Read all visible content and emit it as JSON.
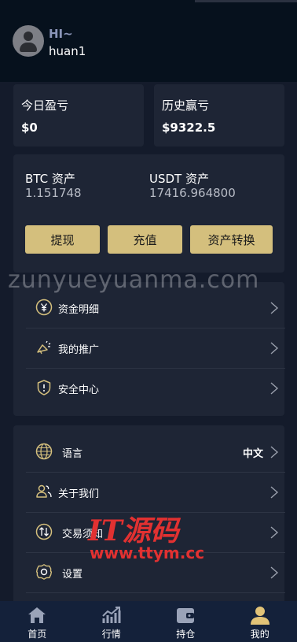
{
  "user": {
    "greeting": "HI~",
    "username": "huan1"
  },
  "pnl": {
    "today_label": "今日盈亏",
    "today_value": "$0",
    "history_label": "历史赢亏",
    "history_value": "$9322.5"
  },
  "assets": {
    "btc_label": "BTC 资产",
    "btc_value": "1.151748",
    "usdt_label": "USDT 资产",
    "usdt_value": "17416.964800",
    "withdraw": "提现",
    "deposit": "充值",
    "transfer": "资产转换"
  },
  "watermark": "zunyueyuanma.com",
  "menu1": [
    {
      "label": "资金明细",
      "icon": "yen-circle-icon"
    },
    {
      "label": "我的推广",
      "icon": "megaphone-icon"
    },
    {
      "label": "安全中心",
      "icon": "shield-icon"
    }
  ],
  "menu2": [
    {
      "label": "语言",
      "value": "中文",
      "icon": "globe-icon"
    },
    {
      "label": "关于我们",
      "icon": "users-icon"
    },
    {
      "label": "交易须知",
      "icon": "exchange-icon"
    },
    {
      "label": "设置",
      "icon": "gear-icon"
    }
  ],
  "overlay": {
    "logo": "IT源码",
    "url": "www.ttym.cc"
  },
  "tabs": [
    {
      "label": "首页",
      "icon": "home-icon"
    },
    {
      "label": "行情",
      "icon": "chart-icon"
    },
    {
      "label": "持仓",
      "icon": "wallet-icon"
    },
    {
      "label": "我的",
      "icon": "user-icon"
    }
  ],
  "colors": {
    "accent": "#d4bf7d",
    "background": "#141b2b",
    "card": "#1e2535",
    "header": "#06111d",
    "tabbar": "#14213a"
  }
}
